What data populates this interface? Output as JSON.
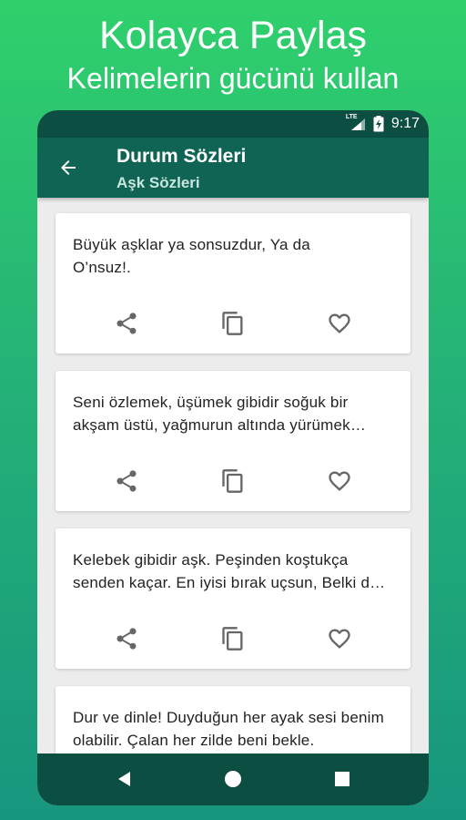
{
  "promo": {
    "title": "Kolayca Paylaş",
    "subtitle": "Kelimelerin gücünü kullan"
  },
  "status_bar": {
    "network": "LTE",
    "time": "9:17"
  },
  "app_bar": {
    "title": "Durum Sözleri",
    "subtitle": "Aşk Sözleri",
    "back_icon": "arrow-back-icon"
  },
  "quotes": [
    {
      "text": "Büyük aşklar ya sonsuzdur, Ya da O’nsuz!."
    },
    {
      "text": "Seni özlemek, üşümek gibidir soğuk bir akşam üstü, yağmurun altında yürümek gibi..."
    },
    {
      "text": "Kelebek gibidir aşk. Peşinden koştukça senden kaçar. En iyisi bırak uçsun, Belki de gelip omzuna konar."
    },
    {
      "text": "Dur ve dinle! Duyduğun her ayak sesi benim olabilir. Çalan her zilde beni bekle."
    }
  ],
  "card_actions": [
    "share-icon",
    "copy-icon",
    "favorite-icon"
  ],
  "colors": {
    "status_bar": "#0c4e42",
    "app_bar": "#0f6454",
    "nav_bar": "#0c4e42",
    "icon_gray": "#666666"
  }
}
